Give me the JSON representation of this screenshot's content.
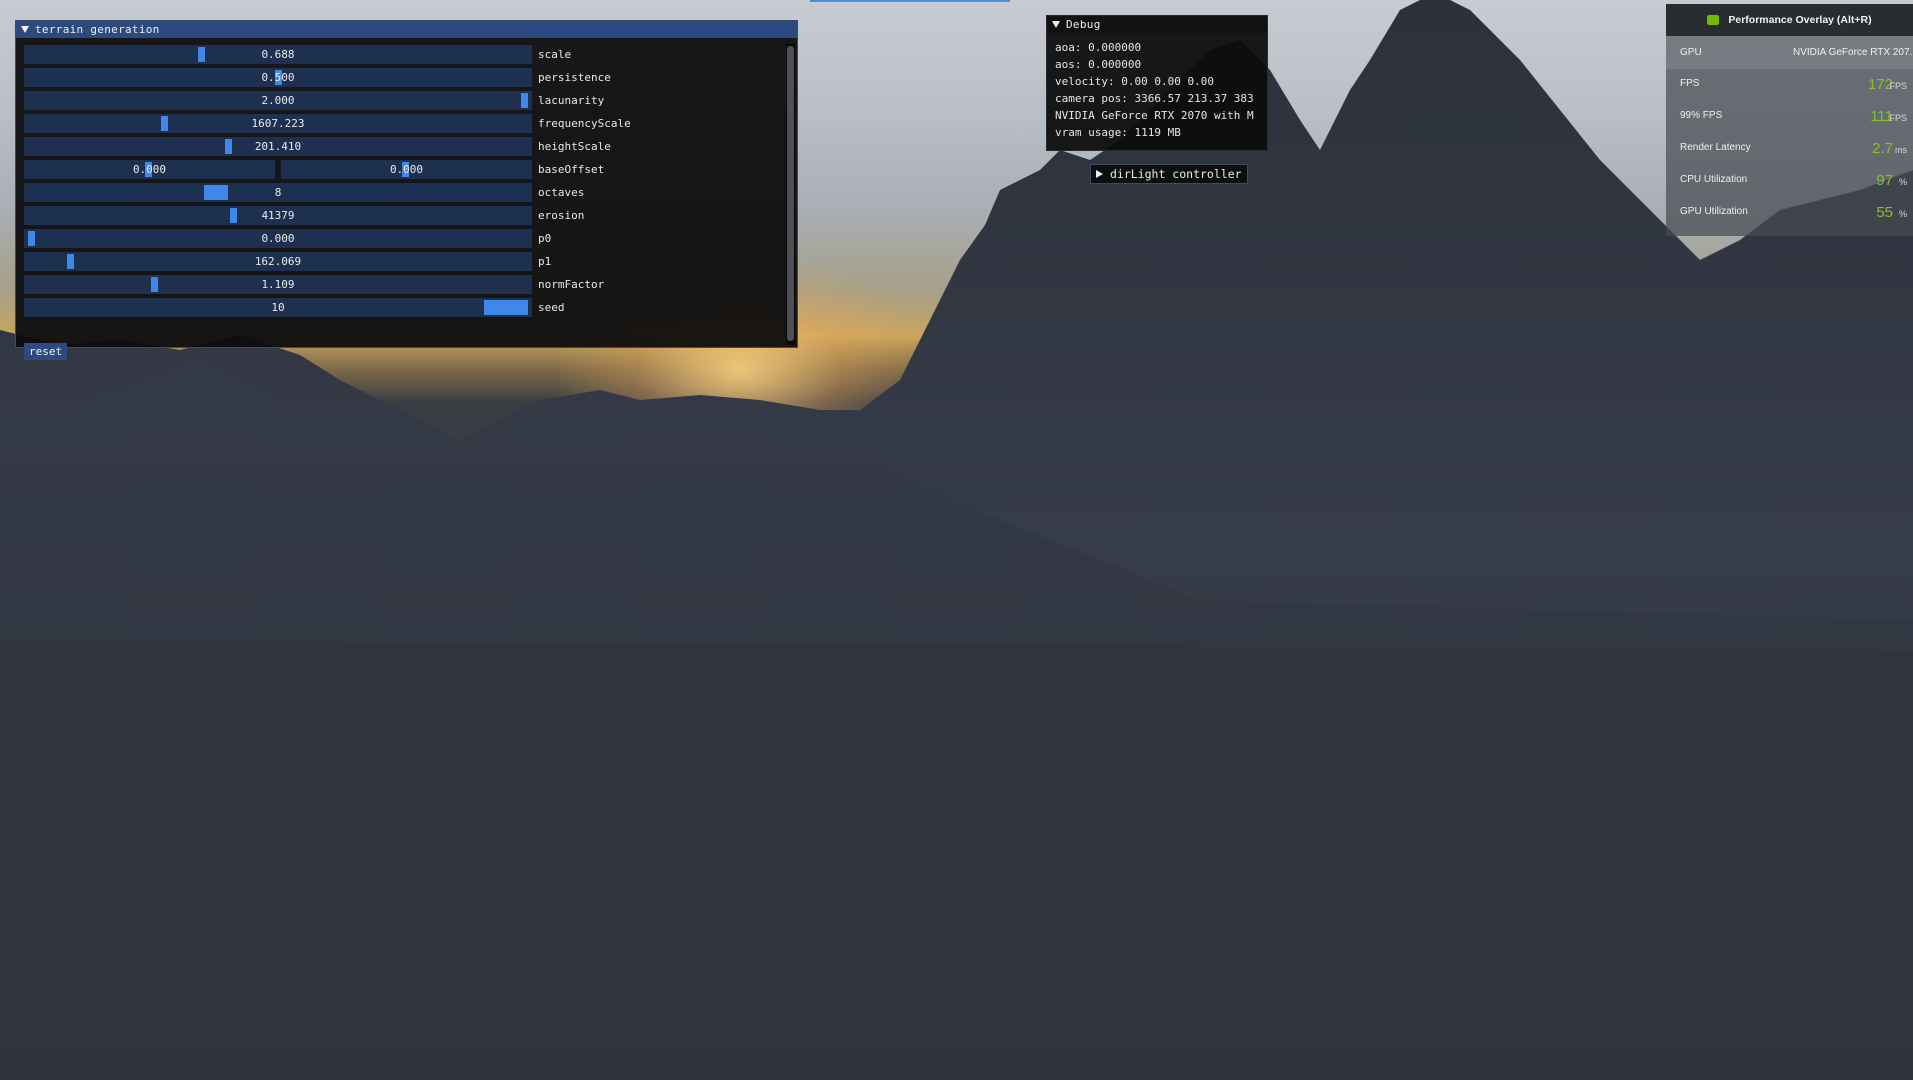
{
  "terrain_window": {
    "title": "terrain generation",
    "rows": [
      {
        "label": "scale",
        "value": "0.688",
        "fill": 0.345
      },
      {
        "label": "persistence",
        "value": "0.500",
        "fill": 0.5
      },
      {
        "label": "lacunarity",
        "value": "2.000",
        "fill": 1.0
      },
      {
        "label": "frequencyScale",
        "value": "1607.223",
        "fill": 0.27
      },
      {
        "label": "heightScale",
        "value": "201.410",
        "fill": 0.4
      },
      {
        "label": "octaves",
        "value": "8",
        "fill": 0.37
      },
      {
        "label": "erosion",
        "value": "41379",
        "fill": 0.41
      },
      {
        "label": "p0",
        "value": "0.000",
        "fill": 0.0
      },
      {
        "label": "p1",
        "value": "162.069",
        "fill": 0.08
      },
      {
        "label": "normFactor",
        "value": "1.109",
        "fill": 0.25
      },
      {
        "label": "seed",
        "value": "10",
        "fill": 1.0
      }
    ],
    "base_offset": {
      "label": "baseOffset",
      "x": "0.000",
      "y": "0.000"
    },
    "reset_label": "reset"
  },
  "debug": {
    "title": "Debug",
    "lines": [
      "aoa: 0.000000",
      "aos: 0.000000",
      "velocity: 0.00 0.00 0.00",
      "camera pos: 3366.57 213.37 383",
      "NVIDIA GeForce RTX 2070 with M",
      "vram usage: 1119 MB"
    ]
  },
  "dirlight": {
    "label": "dirLight controller"
  },
  "overlay": {
    "title": "Performance Overlay (Alt+R)",
    "gpu_label": "GPU",
    "gpu_name": "NVIDIA GeForce RTX 207...",
    "metrics": [
      {
        "label": "FPS",
        "value": "172",
        "unit": "FPS"
      },
      {
        "label": "99% FPS",
        "value": "111",
        "unit": "FPS"
      },
      {
        "label": "Render Latency",
        "value": "2.7",
        "unit": "ms"
      },
      {
        "label": "CPU Utilization",
        "value": "97",
        "unit": "%"
      },
      {
        "label": "GPU Utilization",
        "value": "55",
        "unit": "%"
      }
    ],
    "accent": "#76b900"
  }
}
